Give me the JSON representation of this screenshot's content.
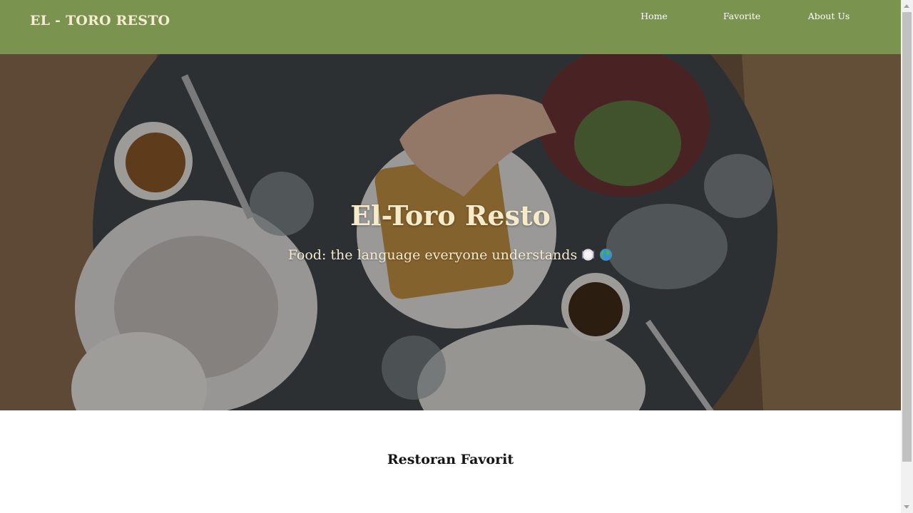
{
  "header": {
    "brand": "EL - TORO RESTO",
    "nav": [
      {
        "label": "Home"
      },
      {
        "label": "Favorite"
      },
      {
        "label": "About Us"
      }
    ],
    "background_color": "#7a9450"
  },
  "hero": {
    "title": "El-Toro Resto",
    "subtitle": "Food: the language everyone understands",
    "emojis": [
      "plate-icon",
      "globe-icon"
    ],
    "image": "food-table-photo"
  },
  "main": {
    "section_title": "Restoran Favorit"
  }
}
